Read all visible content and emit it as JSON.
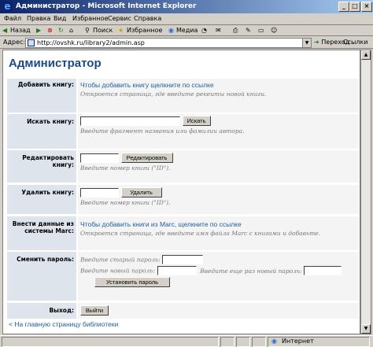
{
  "window": {
    "title": "Администратор - Microsoft Internet Explorer",
    "minimize_symbol": "_",
    "maximize_symbol": "□",
    "close_symbol": "×"
  },
  "menu": {
    "items": [
      "Файл",
      "Правка",
      "Вид",
      "Избранное",
      "Сервис",
      "Справка"
    ]
  },
  "toolbar": {
    "back_label": "Назад",
    "search_label": "Поиск",
    "favorites_label": "Избранное",
    "media_label": "Медиа"
  },
  "address": {
    "label": "Адрес:",
    "url": "http://ovshk.ru/library2/admin.asp",
    "go_label": "Переход",
    "links_label": "Ссылки"
  },
  "page": {
    "title": "Администратор",
    "rows": {
      "add": {
        "label": "Добавить книгу:",
        "link": "Чтобы добавить книгу щелкните по ссылке",
        "hint": "Откроется страница, где введите рекеиты новой книги."
      },
      "search": {
        "label": "Искать книгу:",
        "button": "Искать",
        "hint": "Введите фрагмент названия или фамилии автора."
      },
      "edit": {
        "label": "Редактировать книгу:",
        "button": "Редактировать",
        "hint": "Введите номер книги (\"ID\")."
      },
      "delete": {
        "label": "Удалить книгу:",
        "button": "Удалить",
        "hint": "Введите номер книги (\"ID\")."
      },
      "marc": {
        "label": "Внести данные из системы Marc:",
        "link": "Чтобы добавить книги из Marc, щелкните по ссылке",
        "hint": "Откроется страница, где введите имя файла Marc с книгами и добавьте."
      },
      "password": {
        "label": "Сменить пароль:",
        "old_label": "Введите старый пароль:",
        "new_label": "Введите новый пароль:",
        "repeat_label": "Введите еще раз новый пароль:",
        "button": "Установить пароль"
      },
      "logout": {
        "label": "Выход:",
        "button": "Выйти"
      }
    },
    "back_link": "< На главную страницу библиотеки"
  },
  "status": {
    "zone": "Интернет"
  },
  "colors": {
    "title_gradient_start": "#0a246a",
    "title_gradient_end": "#a6caf0",
    "heading": "#1a4a8a",
    "link": "#1f5fa0",
    "label_bg": "#dde4ec",
    "value_bg": "#f4f4f4"
  }
}
